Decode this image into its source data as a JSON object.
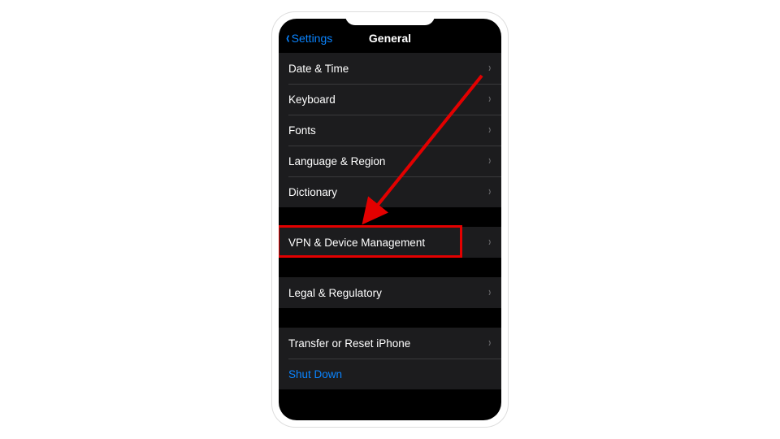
{
  "nav": {
    "back_label": "Settings",
    "title": "General"
  },
  "groups": [
    {
      "items": [
        {
          "label": "Date & Time",
          "name": "date-time-item"
        },
        {
          "label": "Keyboard",
          "name": "keyboard-item"
        },
        {
          "label": "Fonts",
          "name": "fonts-item"
        },
        {
          "label": "Language & Region",
          "name": "language-region-item"
        },
        {
          "label": "Dictionary",
          "name": "dictionary-item"
        }
      ]
    },
    {
      "items": [
        {
          "label": "VPN & Device Management",
          "name": "vpn-device-management-item",
          "highlighted": true
        }
      ]
    },
    {
      "items": [
        {
          "label": "Legal & Regulatory",
          "name": "legal-regulatory-item"
        }
      ]
    },
    {
      "items": [
        {
          "label": "Transfer or Reset iPhone",
          "name": "transfer-reset-item"
        },
        {
          "label": "Shut Down",
          "name": "shut-down-item",
          "style": "shutdown",
          "no_chevron": true
        }
      ]
    }
  ],
  "annotation": {
    "highlight_color": "#e30000",
    "arrow_color": "#e30000"
  }
}
